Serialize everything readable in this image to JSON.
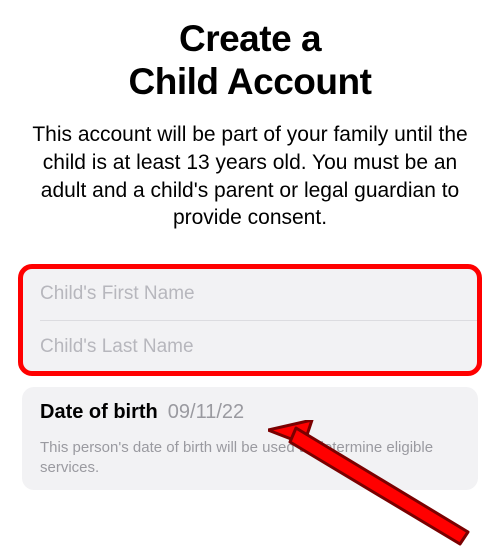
{
  "header": {
    "title_line1": "Create a",
    "title_line2": "Child Account",
    "description": "This account will be part of your family until the child is at least 13 years old. You must be an adult and a child's parent or legal guardian to provide consent."
  },
  "form": {
    "first_name_placeholder": "Child's First Name",
    "last_name_placeholder": "Child's Last Name"
  },
  "dob": {
    "label": "Date of birth",
    "value": "09/11/22",
    "hint": "This person's date of birth will be used to determine eligible services."
  },
  "annotation": {
    "highlight_color": "#ff0000",
    "arrow_color_fill": "#ff0000",
    "arrow_color_stroke": "#7a0000"
  }
}
